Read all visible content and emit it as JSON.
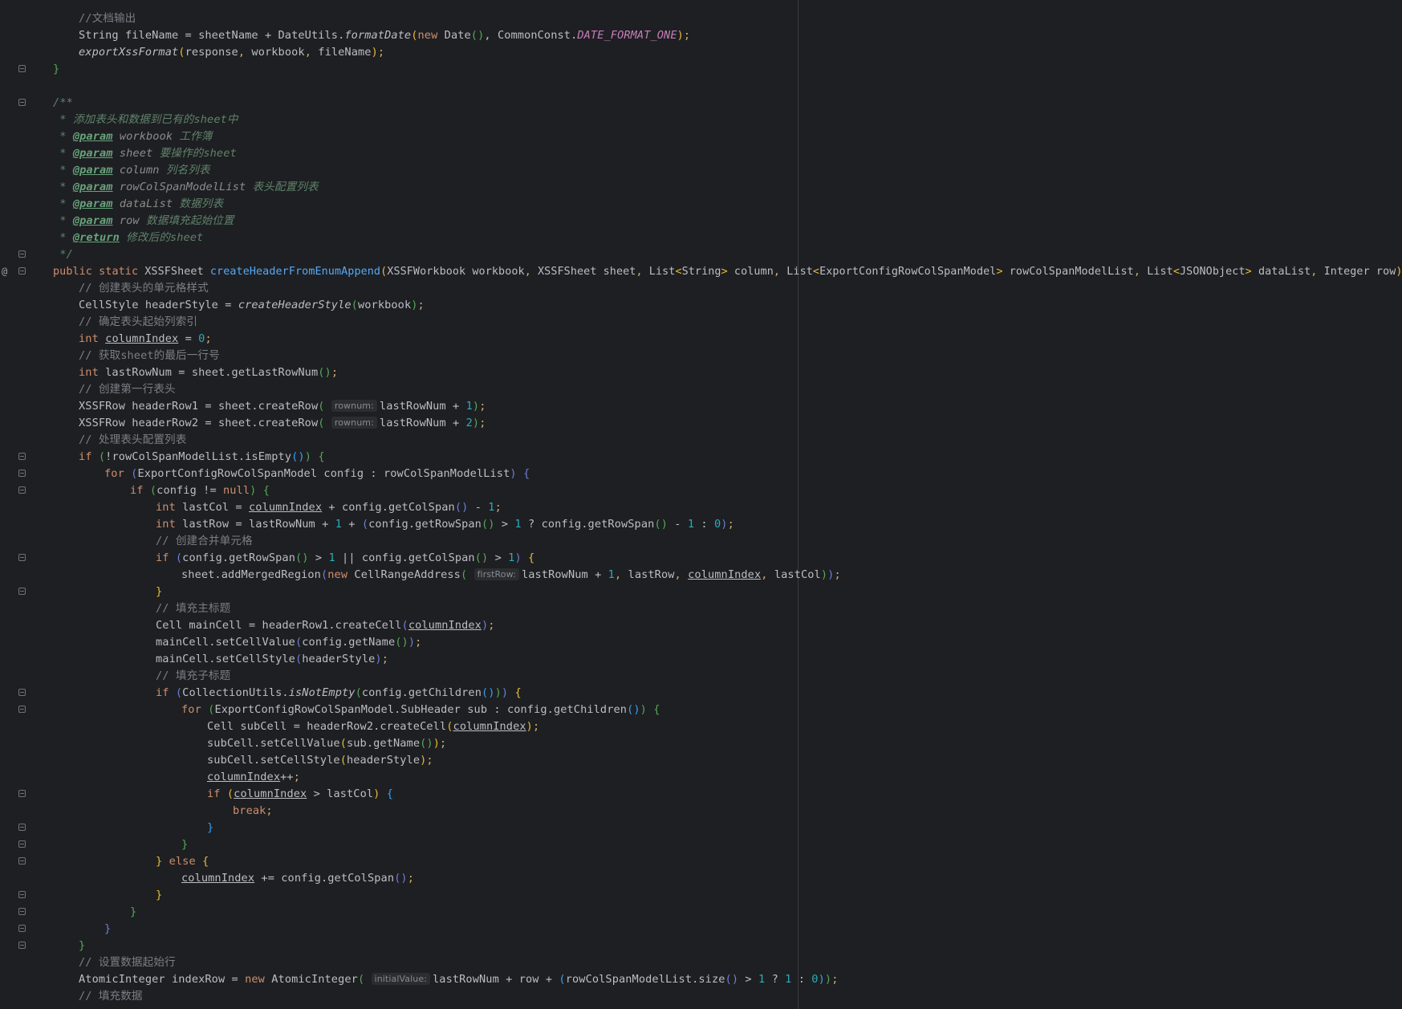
{
  "editor": {
    "language": "Java",
    "theme_background": "#1e1f22",
    "method_marker": "@",
    "colors": {
      "keyword": "#cf8e6d",
      "method_declaration": "#56a8f5",
      "static_field": "#c77dbb",
      "number": "#2aacb8",
      "comment": "#7a7e85",
      "doc_comment": "#5f826b",
      "doc_tag": "#67a37c",
      "inlay_hint_bg": "#2b2d30"
    }
  },
  "lines": [
    "//文档输出",
    "String fileName = sheetName + DateUtils.formatDate(new Date(), CommonConst.DATE_FORMAT_ONE);",
    "exportXssFormat(response, workbook, fileName);",
    "}",
    "",
    "/**",
    " * 添加表头和数据到已有的sheet中",
    " * @param workbook 工作簿",
    " * @param sheet 要操作的sheet",
    " * @param column 列名列表",
    " * @param rowColSpanModelList 表头配置列表",
    " * @param dataList 数据列表",
    " * @param row 数据填充起始位置",
    " * @return 修改后的sheet",
    " */",
    "public static XSSFSheet createHeaderFromEnumAppend(XSSFWorkbook workbook, XSSFSheet sheet, List<String> column, List<ExportConfigRowColSpanModel> rowColSpanModelList, List<JSONObject> dataList, Integer row) {",
    "// 创建表头的单元格样式",
    "CellStyle headerStyle = createHeaderStyle(workbook);",
    "// 确定表头起始列索引",
    "int columnIndex = 0;",
    "// 获取sheet的最后一行号",
    "int lastRowNum = sheet.getLastRowNum();",
    "// 创建第一行表头",
    "XSSFRow headerRow1 = sheet.createRow( rownum: lastRowNum + 1);",
    "XSSFRow headerRow2 = sheet.createRow( rownum: lastRowNum + 2);",
    "// 处理表头配置列表",
    "if (!rowColSpanModelList.isEmpty()) {",
    "for (ExportConfigRowColSpanModel config : rowColSpanModelList) {",
    "if (config != null) {",
    "int lastCol = columnIndex + config.getColSpan() - 1;",
    "int lastRow = lastRowNum + 1 + (config.getRowSpan() > 1 ? config.getRowSpan() - 1 : 0);",
    "// 创建合并单元格",
    "if (config.getRowSpan() > 1 || config.getColSpan() > 1) {",
    "sheet.addMergedRegion(new CellRangeAddress( firstRow: lastRowNum + 1, lastRow, columnIndex, lastCol));",
    "}",
    "// 填充主标题",
    "Cell mainCell = headerRow1.createCell(columnIndex);",
    "mainCell.setCellValue(config.getName());",
    "mainCell.setCellStyle(headerStyle);",
    "// 填充子标题",
    "if (CollectionUtils.isNotEmpty(config.getChildren())) {",
    "for (ExportConfigRowColSpanModel.SubHeader sub : config.getChildren()) {",
    "Cell subCell = headerRow2.createCell(columnIndex);",
    "subCell.setCellValue(sub.getName());",
    "subCell.setCellStyle(headerStyle);",
    "columnIndex++;",
    "if (columnIndex > lastCol) {",
    "break;",
    "}",
    "}",
    "} else {",
    "columnIndex += config.getColSpan();",
    "}",
    "}",
    "}",
    "}",
    "// 设置数据起始行",
    "AtomicInteger indexRow = new AtomicInteger( initialValue: lastRowNum + row + (rowColSpanModelList.size() > 1 ? 1 : 0));",
    "// 填充数据"
  ],
  "inlay_hints": [
    "rownum:",
    "firstRow:",
    "initialValue:"
  ]
}
